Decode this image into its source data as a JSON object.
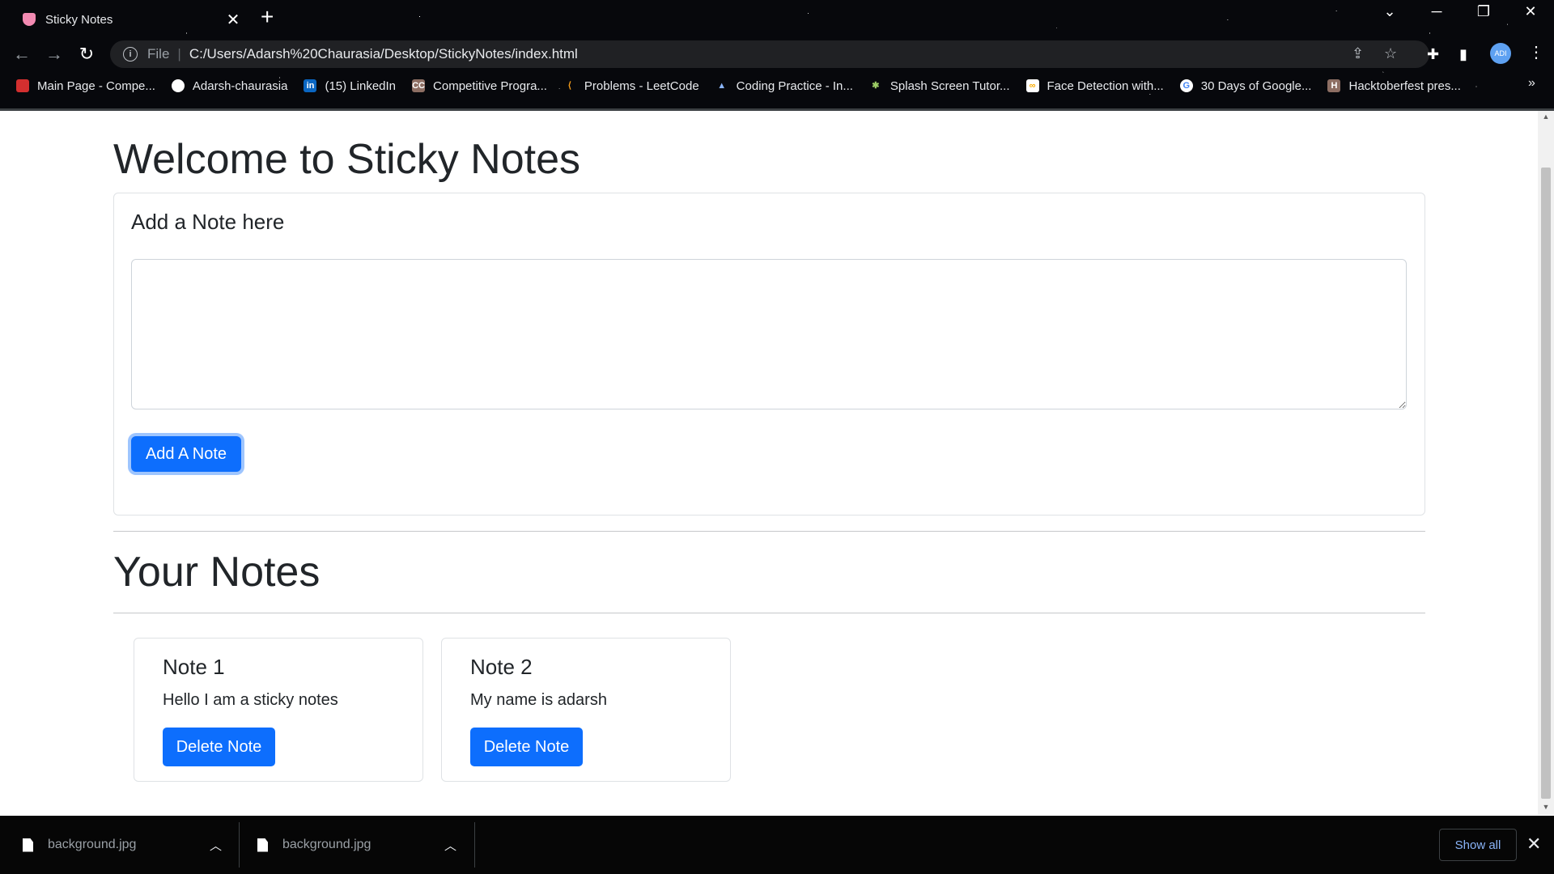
{
  "browser": {
    "tab_title": "Sticky Notes",
    "tab_close": "✕",
    "new_tab": "+",
    "url_scheme": "File",
    "url": "C:/Users/Adarsh%20Chaurasia/Desktop/StickyNotes/index.html",
    "profile_initials": "ADI",
    "bookmarks": [
      {
        "label": "Main Page - Compe...",
        "icon": "shield-icon",
        "color": "#d32f2f"
      },
      {
        "label": "Adarsh-chaurasia",
        "icon": "github-icon",
        "color": "#ffffff"
      },
      {
        "label": "(15) LinkedIn",
        "icon": "linkedin-icon",
        "color": "#0a66c2"
      },
      {
        "label": "Competitive Progra...",
        "icon": "codechef-icon",
        "color": "#8d6e63"
      },
      {
        "label": "Problems - LeetCode",
        "icon": "leetcode-icon",
        "color": "#f89f1b"
      },
      {
        "label": "Coding Practice - In...",
        "icon": "interviewbit-icon",
        "color": "#8ab4f8"
      },
      {
        "label": "Splash Screen Tutor...",
        "icon": "android-icon",
        "color": "#9ccc65"
      },
      {
        "label": "Face Detection with...",
        "icon": "colab-icon",
        "color": "#f9ab00"
      },
      {
        "label": "30 Days of Google...",
        "icon": "google-icon",
        "color": "#4285f4"
      },
      {
        "label": "Hacktoberfest pres...",
        "icon": "hacktoberfest-icon",
        "color": "#ff7043"
      }
    ],
    "bookmarks_more": "»"
  },
  "page": {
    "title": "Welcome to Sticky Notes",
    "add_card": {
      "title": "Add a Note here",
      "textarea_value": "",
      "add_button": "Add A Note"
    },
    "notes_heading": "Your Notes",
    "notes": [
      {
        "title": "Note 1",
        "text": "Hello I am a sticky notes",
        "delete_label": "Delete Note"
      },
      {
        "title": "Note 2",
        "text": "My name is adarsh",
        "delete_label": "Delete Note"
      }
    ]
  },
  "downloads": {
    "items": [
      {
        "file_name": "background.jpg"
      },
      {
        "file_name": "background.jpg"
      }
    ],
    "show_all": "Show all",
    "close": "✕"
  },
  "colors": {
    "primary": "#0d6efd",
    "focus_ring": "#9ec5fe",
    "text": "#212529"
  }
}
